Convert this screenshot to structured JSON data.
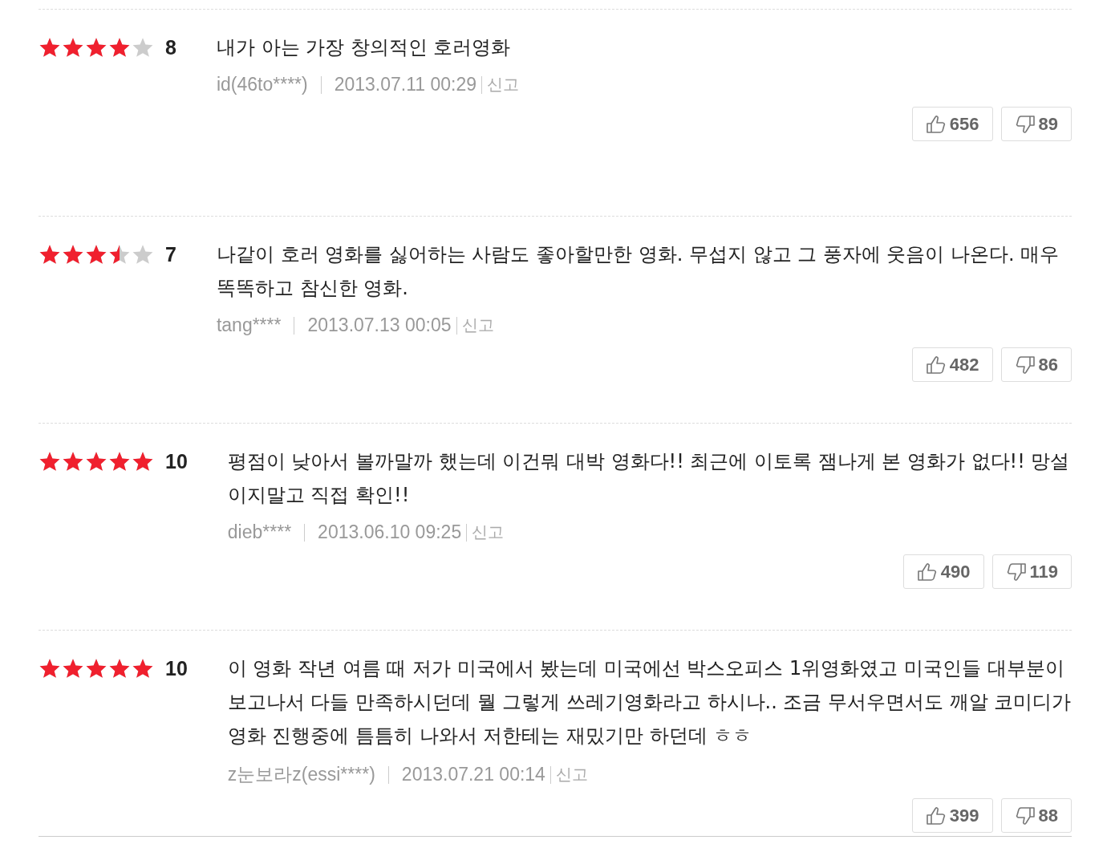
{
  "reviews": [
    {
      "stars": 4,
      "score": "8",
      "text": "내가 아는 가장 창의적인 호러영화",
      "author": "id(46to****)",
      "date": "2013.07.11 00:29",
      "report": "신고",
      "likes": "656",
      "dislikes": "89"
    },
    {
      "stars": 3.5,
      "score": "7",
      "text": "나같이 호러 영화를 싫어하는 사람도 좋아할만한 영화. 무섭지 않고 그 풍자에 웃음이 나온다. 매우 똑똑하고 참신한 영화.",
      "author": "tang****",
      "date": "2013.07.13 00:05",
      "report": "신고",
      "likes": "482",
      "dislikes": "86"
    },
    {
      "stars": 5,
      "score": "10",
      "text": "평점이 낮아서 볼까말까 했는데 이건뭐 대박 영화다!! 최근에 이토록 잼나게 본 영화가 없다!! 망설이지말고 직접 확인!!",
      "author": "dieb****",
      "date": "2013.06.10 09:25",
      "report": "신고",
      "likes": "490",
      "dislikes": "119"
    },
    {
      "stars": 5,
      "score": "10",
      "text": "이 영화 작년 여름 때 저가 미국에서 봤는데 미국에선 박스오피스 1위영화였고 미국인들 대부분이 보고나서 다들 만족하시던데 뭘 그렇게 쓰레기영화라고 하시나.. 조금 무서우면서도 깨알 코미디가 영화 진행중에 틈틈히 나와서 저한테는 재밌기만 하던데 ㅎㅎ",
      "author": "z눈보라z(essi****)",
      "date": "2013.07.21 00:14",
      "report": "신고",
      "likes": "399",
      "dislikes": "88"
    }
  ]
}
